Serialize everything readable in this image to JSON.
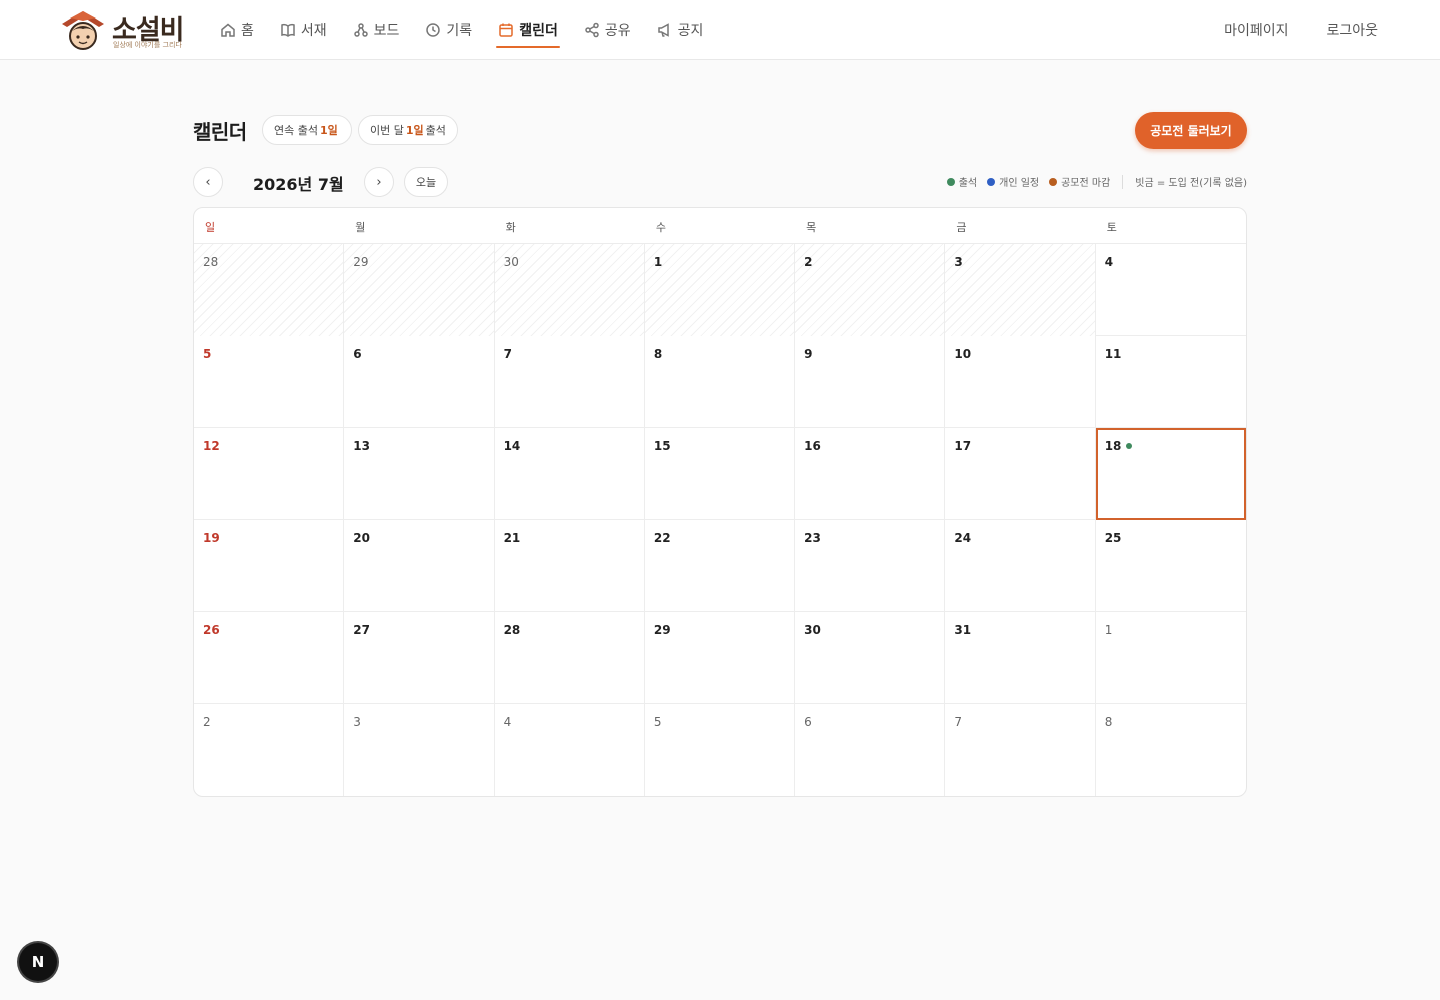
{
  "brand": {
    "name": "소설비",
    "tagline": "일상에 이야기를 그리다"
  },
  "nav": {
    "items": [
      {
        "label": "홈",
        "icon": "home-icon"
      },
      {
        "label": "서재",
        "icon": "book-icon"
      },
      {
        "label": "보드",
        "icon": "board-icon"
      },
      {
        "label": "기록",
        "icon": "clock-icon"
      },
      {
        "label": "캘린더",
        "icon": "calendar-icon",
        "active": true
      },
      {
        "label": "공유",
        "icon": "share-icon"
      },
      {
        "label": "공지",
        "icon": "megaphone-icon"
      }
    ],
    "mypage": "마이페이지",
    "logout": "로그아웃"
  },
  "page": {
    "title": "캘린더",
    "streak": {
      "prefix": "연속 출석",
      "value": "1일"
    },
    "monthly": {
      "prefix": "이번 달",
      "value": "1일",
      "suffix": "출석"
    },
    "cta": "공모전 둘러보기"
  },
  "calendar_nav": {
    "prev": "‹",
    "next": "›",
    "month_label": "2026년 7월",
    "today": "오늘"
  },
  "legend": {
    "items": [
      {
        "label": "출석",
        "color": "#3f8a5e"
      },
      {
        "label": "개인 일정",
        "color": "#2f5fc4"
      },
      {
        "label": "공모전 마감",
        "color": "#b85e1f"
      }
    ],
    "note": "빗금 = 도입 전(기록 없음)"
  },
  "weekdays": [
    "일",
    "월",
    "화",
    "수",
    "목",
    "금",
    "토"
  ],
  "weeks": [
    [
      {
        "d": "28",
        "other": true,
        "hatch": true
      },
      {
        "d": "29",
        "other": true,
        "hatch": true
      },
      {
        "d": "30",
        "other": true,
        "hatch": true
      },
      {
        "d": "1",
        "hatch": true
      },
      {
        "d": "2",
        "hatch": true
      },
      {
        "d": "3",
        "hatch": true
      },
      {
        "d": "4"
      }
    ],
    [
      {
        "d": "5"
      },
      {
        "d": "6"
      },
      {
        "d": "7"
      },
      {
        "d": "8"
      },
      {
        "d": "9"
      },
      {
        "d": "10"
      },
      {
        "d": "11"
      }
    ],
    [
      {
        "d": "12"
      },
      {
        "d": "13"
      },
      {
        "d": "14"
      },
      {
        "d": "15"
      },
      {
        "d": "16"
      },
      {
        "d": "17"
      },
      {
        "d": "18",
        "today": true,
        "attended": true
      }
    ],
    [
      {
        "d": "19"
      },
      {
        "d": "20"
      },
      {
        "d": "21"
      },
      {
        "d": "22"
      },
      {
        "d": "23"
      },
      {
        "d": "24"
      },
      {
        "d": "25"
      }
    ],
    [
      {
        "d": "26"
      },
      {
        "d": "27"
      },
      {
        "d": "28"
      },
      {
        "d": "29"
      },
      {
        "d": "30"
      },
      {
        "d": "31"
      },
      {
        "d": "1",
        "other": true
      }
    ],
    [
      {
        "d": "2",
        "other": true
      },
      {
        "d": "3",
        "other": true
      },
      {
        "d": "4",
        "other": true
      },
      {
        "d": "5",
        "other": true
      },
      {
        "d": "6",
        "other": true
      },
      {
        "d": "7",
        "other": true
      },
      {
        "d": "8",
        "other": true
      }
    ]
  ],
  "dev_badge": "N"
}
